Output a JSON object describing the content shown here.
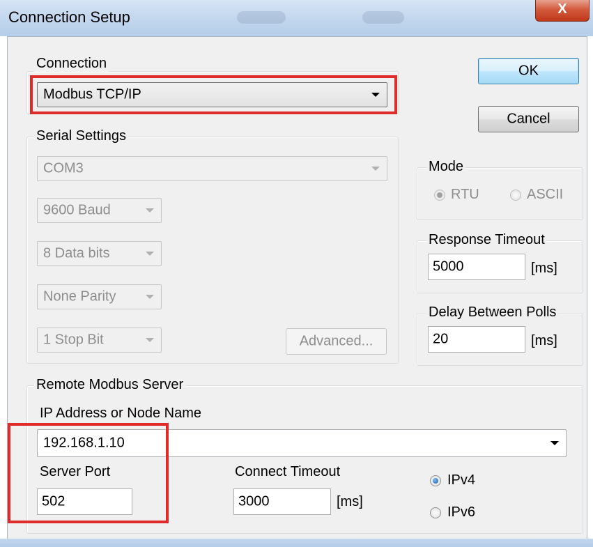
{
  "window": {
    "title": "Connection Setup",
    "close_label": "X"
  },
  "connection": {
    "legend": "Connection",
    "selected": "Modbus TCP/IP"
  },
  "buttons": {
    "ok": "OK",
    "cancel": "Cancel",
    "advanced": "Advanced..."
  },
  "serial": {
    "legend": "Serial Settings",
    "port": "COM3",
    "baud": "9600 Baud",
    "data_bits": "8 Data bits",
    "parity": "None Parity",
    "stop_bits": "1 Stop Bit"
  },
  "mode": {
    "legend": "Mode",
    "options": [
      "RTU",
      "ASCII"
    ],
    "selected": "RTU"
  },
  "response_timeout": {
    "legend": "Response Timeout",
    "value": "5000",
    "unit": "[ms]"
  },
  "delay_between_polls": {
    "legend": "Delay Between Polls",
    "value": "20",
    "unit": "[ms]"
  },
  "remote": {
    "legend": "Remote Modbus Server",
    "ip_label": "IP Address or Node Name",
    "ip_value": "192.168.1.10",
    "port_label": "Server Port",
    "port_value": "502",
    "connect_timeout_label": "Connect Timeout",
    "connect_timeout_value": "3000",
    "connect_timeout_unit": "[ms]",
    "ip_versions": [
      "IPv4",
      "IPv6"
    ],
    "ip_version_selected": "IPv4"
  },
  "colors": {
    "highlight": "#e02b2b",
    "title_bar": "#c3d7ee",
    "close_button": "#d35a3c"
  }
}
